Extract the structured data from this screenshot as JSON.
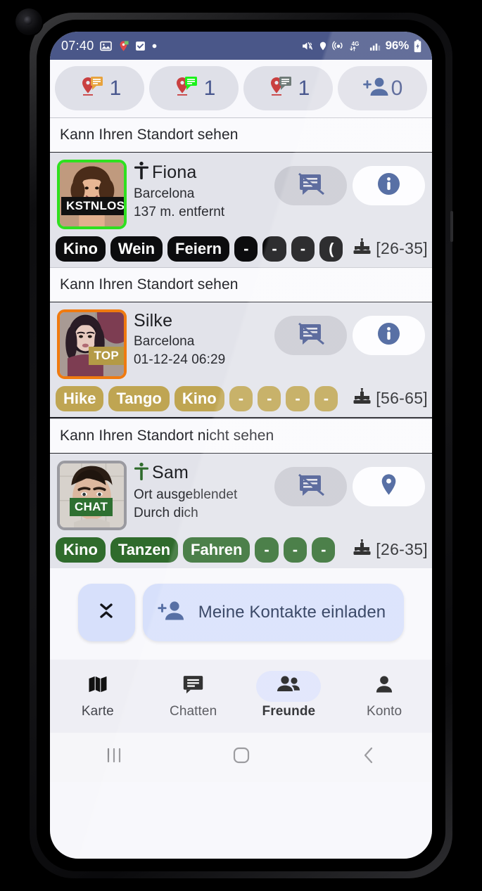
{
  "status_bar": {
    "clock": "07:40",
    "battery": "96%",
    "network": "4G",
    "icons": [
      "image-icon",
      "location-pin-icon",
      "checkbox-icon",
      "dot-icon",
      "mute-icon",
      "location-icon",
      "hotspot-icon",
      "network-4g-icon",
      "signal-bars-icon",
      "battery-charging-icon"
    ]
  },
  "top_counters": [
    {
      "name": "pin-orange-chat-counter",
      "icon": "pin-chat-orange-icon",
      "value": "1",
      "accent": "#e8a33d"
    },
    {
      "name": "pin-green-chat-counter",
      "icon": "pin-chat-green-icon",
      "value": "1",
      "accent": "#1bf21b"
    },
    {
      "name": "pin-grey-chat-counter",
      "icon": "pin-chat-grey-icon",
      "value": "1",
      "accent": "#6f7b78"
    },
    {
      "name": "add-contact-counter",
      "icon": "person-add-icon",
      "value": "0",
      "accent": "#3c5896"
    }
  ],
  "sections": [
    {
      "header": "Kann Ihren Standort sehen",
      "contact": {
        "name": "Fiona",
        "gender_icon": "person-accessibility-icon",
        "gender_icon_color": "#1a1b1f",
        "city": "Barcelona",
        "detail": "137 m. entfernt",
        "avatar_badge": "KSTNLOS",
        "avatar_badge_style": "black",
        "avatar_border": "green",
        "chat_icon": "chat-disabled-icon",
        "second_action_icon": "info-icon",
        "chips": [
          "Kino",
          "Wein",
          "Feiern",
          "-",
          "-",
          "-",
          "("
        ],
        "chip_style": "black",
        "age_range": "[26-35]",
        "age_icon": "birthday-cake-icon"
      }
    },
    {
      "header": "Kann Ihren Standort sehen",
      "contact": {
        "name": "Silke",
        "gender_icon": "",
        "gender_icon_color": "",
        "city": "Barcelona",
        "detail": "01-12-24 06:29",
        "avatar_badge": "TOP",
        "avatar_badge_style": "gold",
        "avatar_border": "orange",
        "chat_icon": "chat-disabled-icon",
        "second_action_icon": "info-icon",
        "chips": [
          "Hike",
          "Tango",
          "Kino",
          "-",
          "-",
          "-",
          "-"
        ],
        "chip_style": "gold",
        "age_range": "[56-65]",
        "age_icon": "birthday-cake-icon"
      }
    },
    {
      "header": "Kann Ihren Standort nicht sehen",
      "contact": {
        "name": "Sam",
        "gender_icon": "person-accessibility-icon",
        "gender_icon_color": "#2f6b2c",
        "city": "Ort ausgeblendet",
        "detail": "Durch dich",
        "avatar_badge": "CHAT",
        "avatar_badge_style": "green",
        "avatar_border": "grey",
        "chat_icon": "chat-disabled-icon",
        "second_action_icon": "location-pin-icon",
        "chips": [
          "Kino",
          "Tanzen",
          "Fahren",
          "-",
          "-",
          "-"
        ],
        "chip_style": "green",
        "age_range": "[26-35]",
        "age_icon": "birthday-cake-icon"
      }
    }
  ],
  "bottom_actions": {
    "collapse_icon": "collapse-chevrons-icon",
    "invite_icon": "person-add-icon",
    "invite_label": "Meine Kontakte einladen"
  },
  "bottom_nav": [
    {
      "label": "Karte",
      "icon": "map-icon",
      "active": false
    },
    {
      "label": "Chatten",
      "icon": "chat-bubble-icon",
      "active": false
    },
    {
      "label": "Freunde",
      "icon": "people-icon",
      "active": true
    },
    {
      "label": "Konto",
      "icon": "person-icon",
      "active": false
    }
  ],
  "system_nav": [
    {
      "name": "recents-button",
      "icon": "recents-bars-icon"
    },
    {
      "name": "home-button",
      "icon": "home-square-icon"
    },
    {
      "name": "back-button",
      "icon": "back-chevron-icon"
    }
  ],
  "colors": {
    "status_bar_bg": "#4a5789",
    "accent_blue": "#48578e",
    "pill_bg": "#dfe0e8",
    "card_bg": "#e2e3ea",
    "invite_bg": "#d7e0fb"
  }
}
